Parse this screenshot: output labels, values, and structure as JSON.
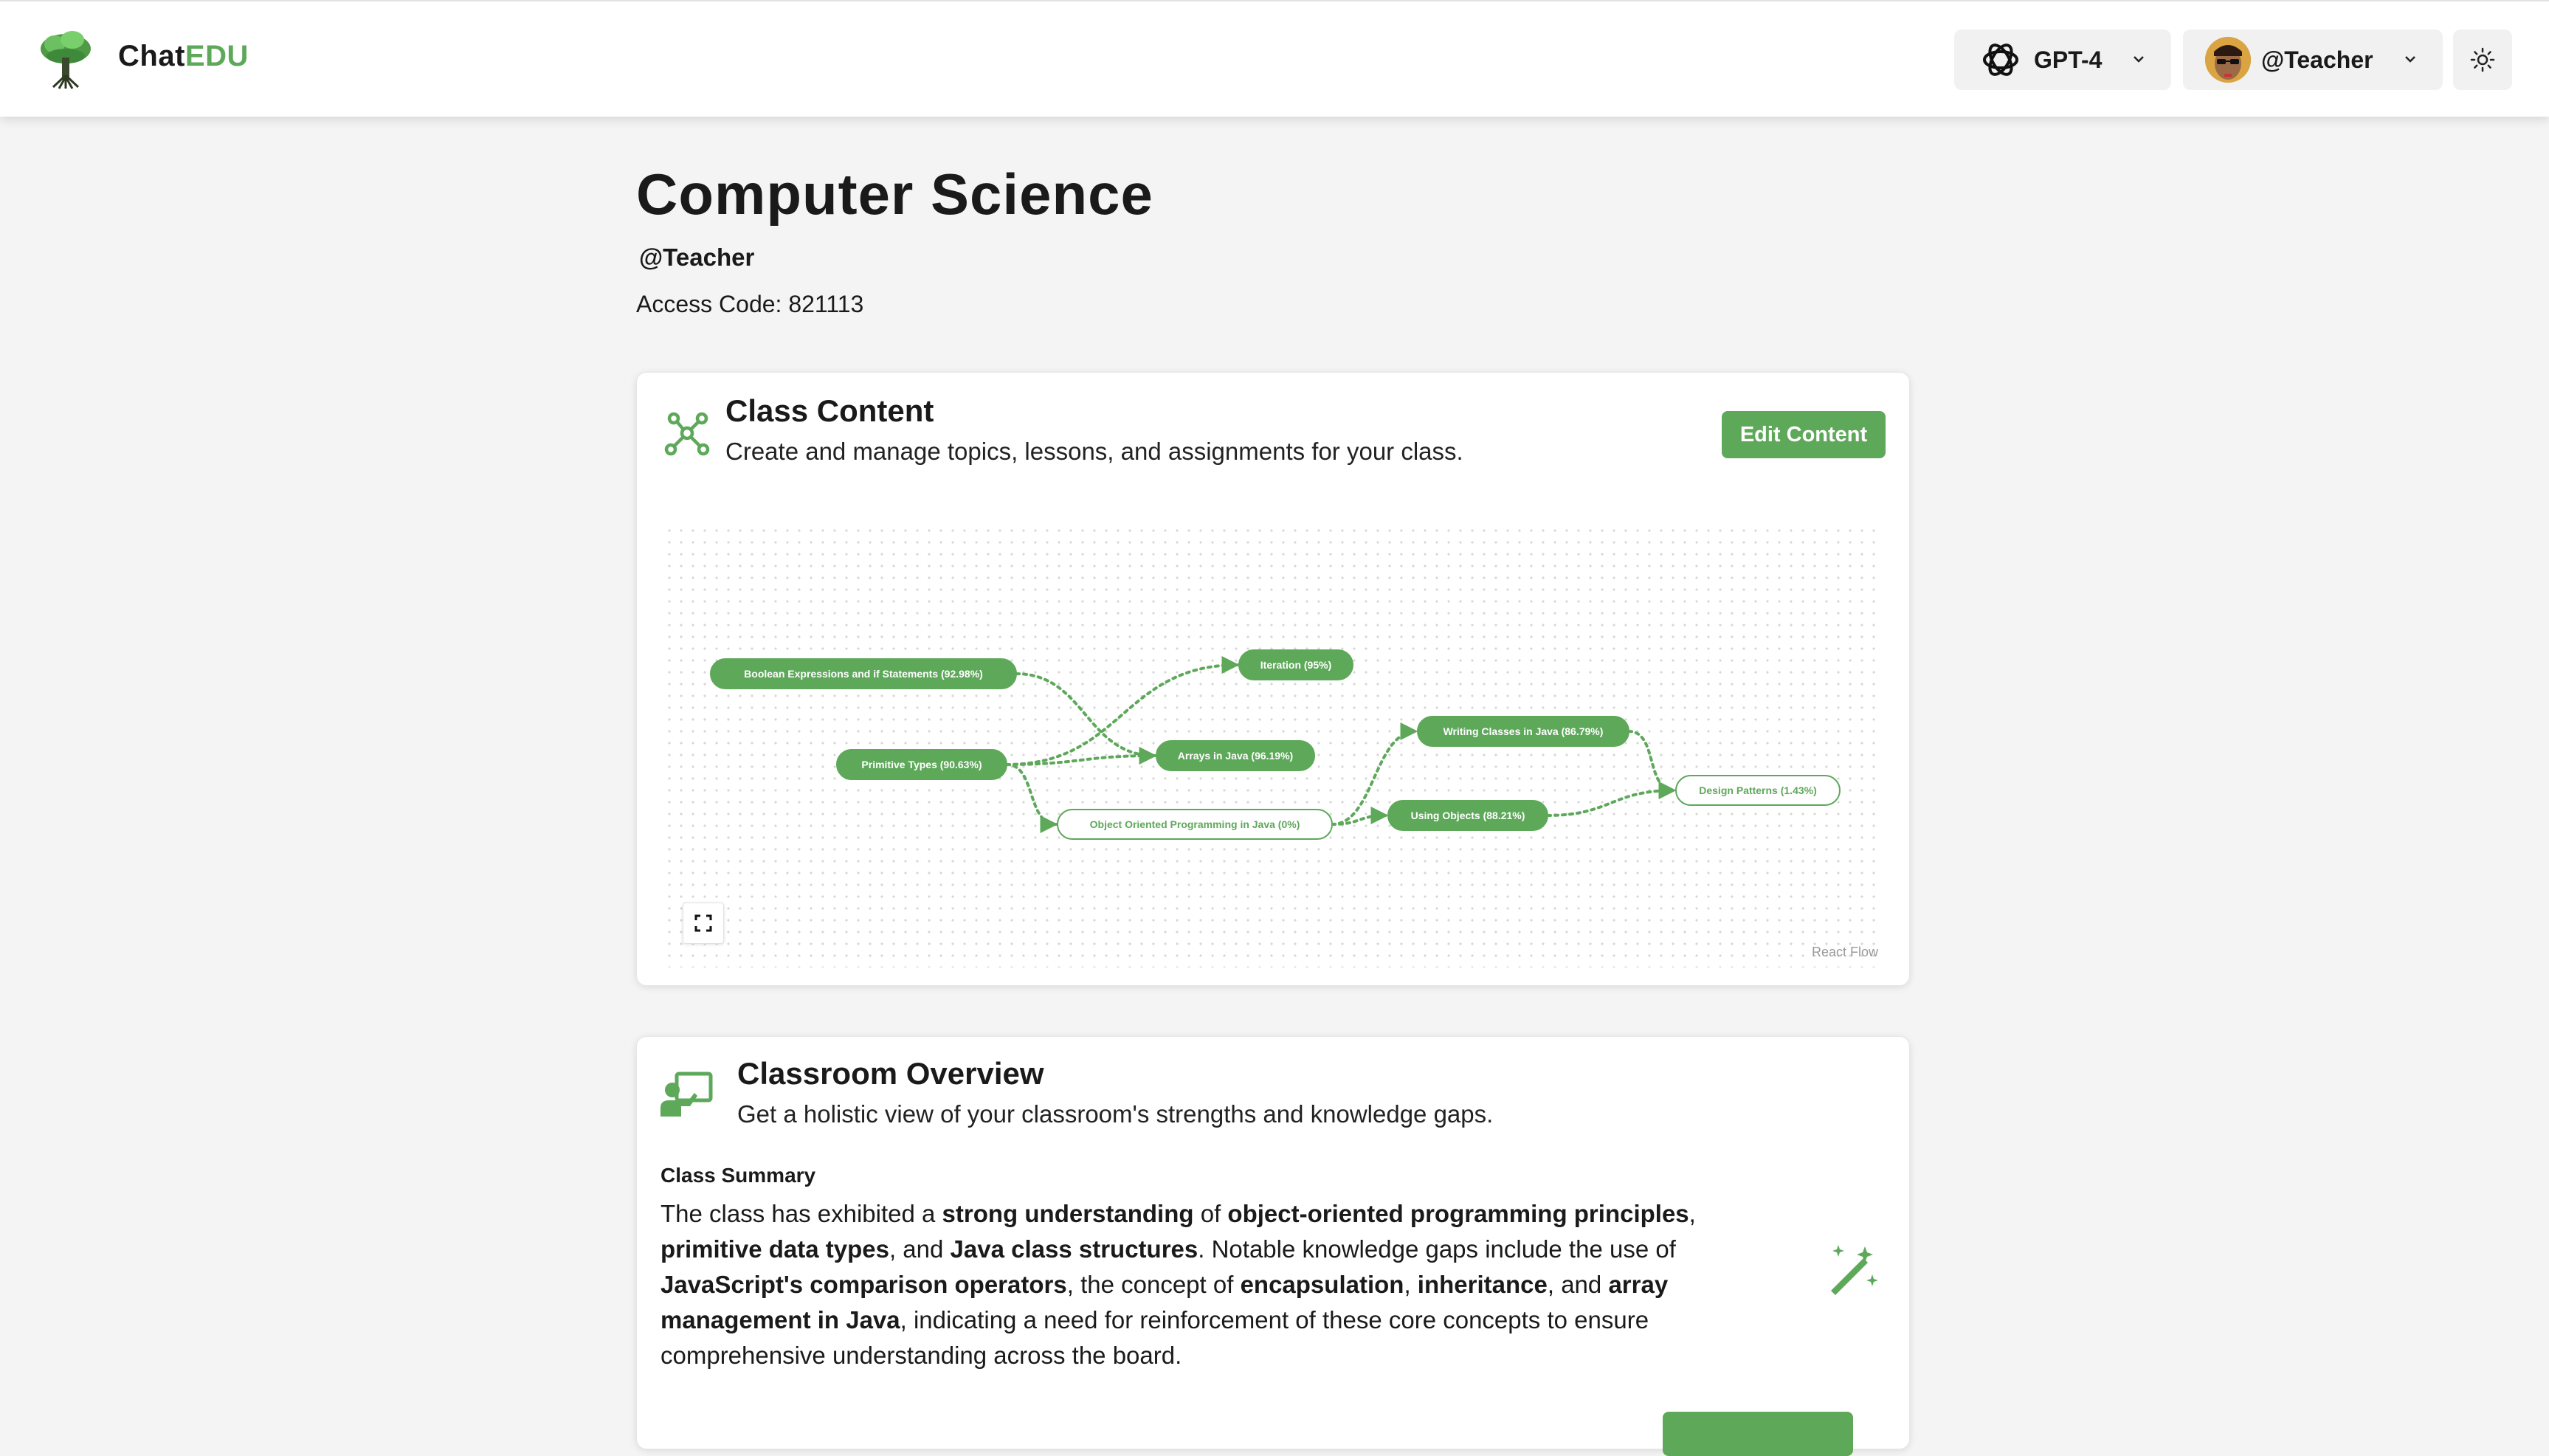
{
  "colors": {
    "accent": "#5ea85a",
    "node_outline_text": "#5ea85a"
  },
  "header": {
    "brand_prefix": "Chat",
    "brand_suffix": "EDU",
    "model_label": "GPT-4",
    "user_label": "@Teacher"
  },
  "page": {
    "title": "Computer Science",
    "owner": "@Teacher",
    "access_code": "Access Code: 821113"
  },
  "class_content": {
    "title": "Class Content",
    "subtitle": "Create and manage topics, lessons, and assignments for your class.",
    "edit_label": "Edit Content",
    "attribution": "React Flow",
    "nodes": [
      {
        "id": "bool",
        "label": "Boolean Expressions and if Statements (92.98%)",
        "style": "filled"
      },
      {
        "id": "iter",
        "label": "Iteration (95%)",
        "style": "filled"
      },
      {
        "id": "prim",
        "label": "Primitive Types (90.63%)",
        "style": "filled"
      },
      {
        "id": "arr",
        "label": "Arrays in Java (96.19%)",
        "style": "filled"
      },
      {
        "id": "oop",
        "label": "Object Oriented Programming in Java (0%)",
        "style": "outline"
      },
      {
        "id": "write",
        "label": "Writing Classes in Java (86.79%)",
        "style": "filled"
      },
      {
        "id": "using",
        "label": "Using Objects (88.21%)",
        "style": "filled"
      },
      {
        "id": "design",
        "label": "Design Patterns (1.43%)",
        "style": "outline"
      }
    ],
    "edges": [
      [
        "bool",
        "arr"
      ],
      [
        "prim",
        "iter"
      ],
      [
        "prim",
        "arr"
      ],
      [
        "prim",
        "oop"
      ],
      [
        "oop",
        "write"
      ],
      [
        "oop",
        "using"
      ],
      [
        "write",
        "design"
      ],
      [
        "using",
        "design"
      ]
    ]
  },
  "overview": {
    "title": "Classroom Overview",
    "subtitle": "Get a holistic view of your classroom's strengths and knowledge gaps.",
    "summary_label": "Class Summary",
    "summary_segments": [
      {
        "t": "The class has exhibited a "
      },
      {
        "t": "strong understanding",
        "b": true
      },
      {
        "t": " of "
      },
      {
        "t": "object-oriented programming principles",
        "b": true
      },
      {
        "t": ", "
      },
      {
        "t": "primitive data types",
        "b": true
      },
      {
        "t": ", and "
      },
      {
        "t": "Java class structures",
        "b": true
      },
      {
        "t": ". Notable knowledge gaps include the use of "
      },
      {
        "t": "JavaScript's comparison operators",
        "b": true
      },
      {
        "t": ", the concept of "
      },
      {
        "t": "encapsulation",
        "b": true
      },
      {
        "t": ", "
      },
      {
        "t": "inheritance",
        "b": true
      },
      {
        "t": ", and "
      },
      {
        "t": "array management in Java",
        "b": true
      },
      {
        "t": ", indicating a need for reinforcement of these core concepts to ensure comprehensive understanding across the board."
      }
    ]
  }
}
